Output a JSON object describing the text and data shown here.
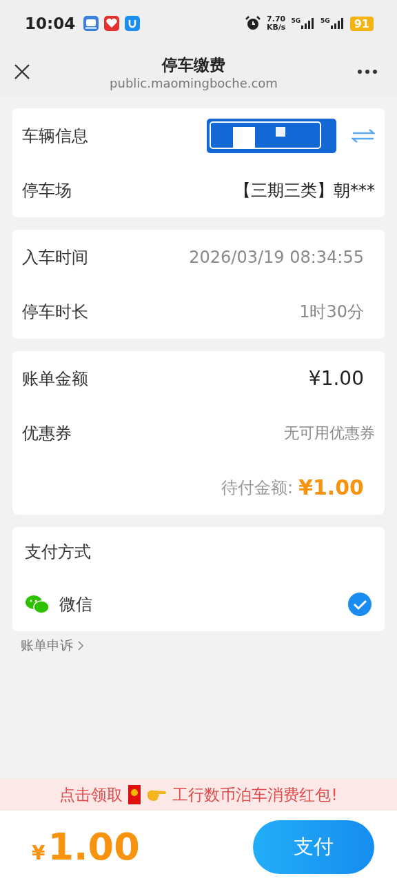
{
  "status_bar": {
    "time": "10:04",
    "net_speed": "7.70",
    "net_speed_unit": "KB/s",
    "signal_1": "5G",
    "signal_2": "5G",
    "battery": "91"
  },
  "header": {
    "title": "停车缴费",
    "url": "public.maomingboche.com"
  },
  "vehicle_card": {
    "rows": [
      {
        "label": "车辆信息",
        "kind": "plate"
      },
      {
        "label": "停车场",
        "kind": "text",
        "value": "【三期三类】朝***"
      }
    ]
  },
  "time_card": {
    "rows": [
      {
        "label": "入车时间",
        "value": "2026/03/19 08:34:55"
      },
      {
        "label": "停车时长",
        "value": "1时30分"
      }
    ]
  },
  "bill_card": {
    "amount_label": "账单金额",
    "amount": "¥1.00",
    "coupon_label": "优惠券",
    "coupon_value": "无可用优惠券",
    "due_label": "待付金额:",
    "due": "¥1.00"
  },
  "payment": {
    "title": "支付方式",
    "methods": [
      {
        "name": "微信",
        "selected": true
      }
    ]
  },
  "appeal_link": "账单申诉",
  "banner": {
    "lead": "点击领取",
    "text": "工行数币泊车消费红包!"
  },
  "footer": {
    "currency": "¥",
    "amount": "1.00",
    "pay_button": "支付"
  }
}
